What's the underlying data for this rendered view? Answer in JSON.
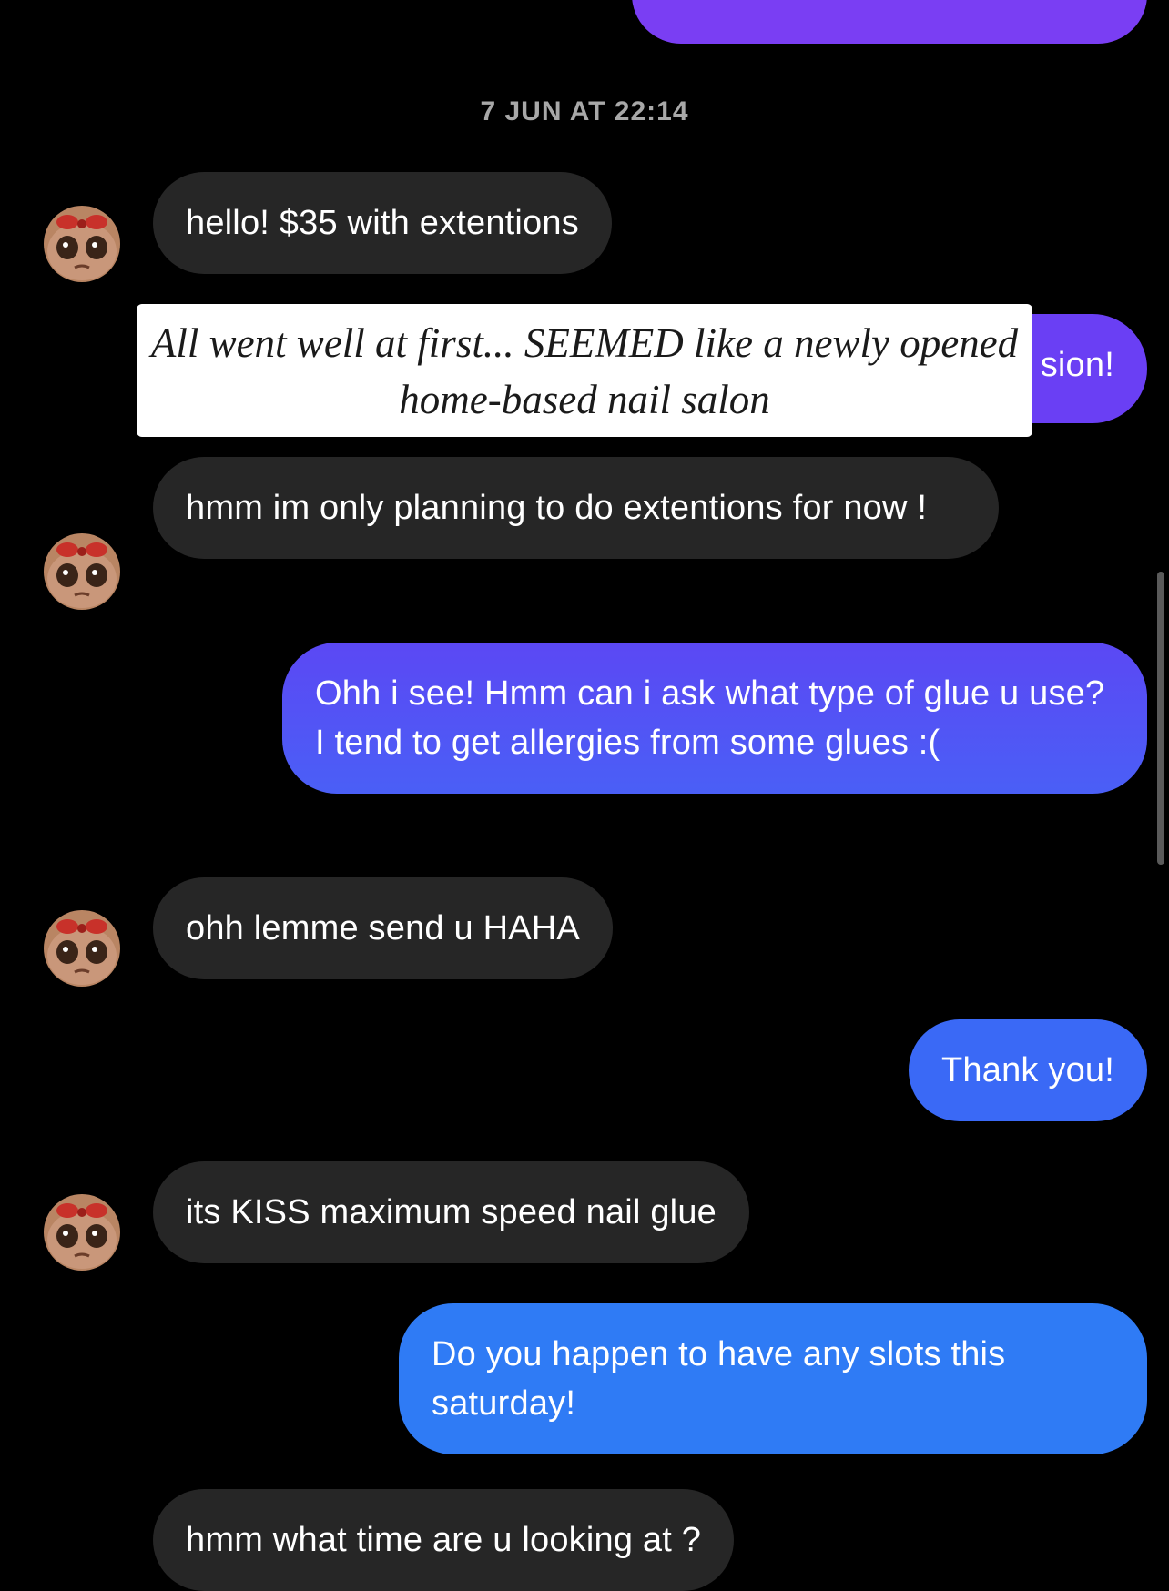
{
  "conversation": {
    "timestamp": "7 JUN AT 22:14",
    "messages": [
      {
        "from": "them",
        "text": "hello! $35 with extentions"
      },
      {
        "from": "me",
        "text": "sion!"
      },
      {
        "from": "them",
        "text": "hmm im only planning to do extentions for now !"
      },
      {
        "from": "me",
        "text": "Ohh i see! Hmm can i ask what type of glue u use? I tend to get allergies from some glues :("
      },
      {
        "from": "them",
        "text": "ohh lemme send u HAHA"
      },
      {
        "from": "me",
        "text": "Thank you!"
      },
      {
        "from": "them",
        "text": "its KISS maximum speed nail glue"
      },
      {
        "from": "me",
        "text": "Do you happen to have any slots this saturday!"
      },
      {
        "from": "them",
        "text": "hmm what time are u looking at ?"
      }
    ]
  },
  "overlay_caption": {
    "line1": "All went well at first... SEEMED like a newly opened",
    "line2": "home-based nail salon"
  },
  "colors": {
    "incoming_bubble": "#262626",
    "outgoing_purple": "#7b3ff2",
    "outgoing_blue": "#2f7bf5",
    "timestamp": "#a8a8a8"
  },
  "icons": {
    "avatar": "cartoon-face-avatar-icon"
  }
}
